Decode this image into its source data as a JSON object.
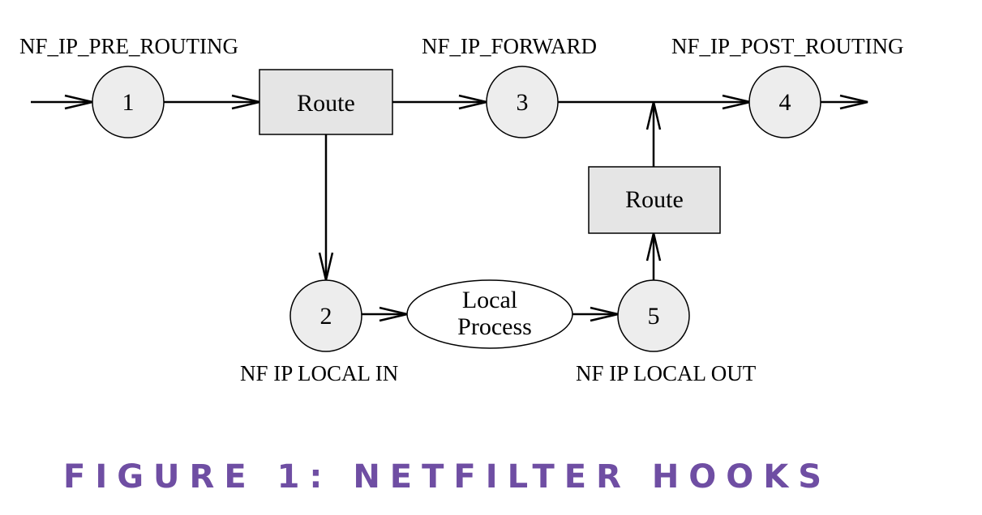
{
  "diagram": {
    "hook_labels": {
      "pre_routing": "NF_IP_PRE_ROUTING",
      "forward": "NF_IP_FORWARD",
      "post_routing": "NF_IP_POST_ROUTING",
      "local_in": "NF IP LOCAL IN",
      "local_out": "NF IP LOCAL OUT"
    },
    "nodes": {
      "hook1": "1",
      "hook2": "2",
      "hook3": "3",
      "hook4": "4",
      "hook5": "5",
      "route_top": "Route",
      "route_right": "Route",
      "local_process_line1": "Local",
      "local_process_line2": "Process"
    },
    "edges": [
      {
        "from": "input",
        "to": "hook1"
      },
      {
        "from": "hook1",
        "to": "route_top"
      },
      {
        "from": "route_top",
        "to": "hook3"
      },
      {
        "from": "route_top",
        "to": "hook2"
      },
      {
        "from": "hook3",
        "to": "hook4"
      },
      {
        "from": "hook2",
        "to": "local_process"
      },
      {
        "from": "local_process",
        "to": "hook5"
      },
      {
        "from": "hook5",
        "to": "route_right"
      },
      {
        "from": "route_right",
        "to": "hook4"
      },
      {
        "from": "hook4",
        "to": "output"
      }
    ],
    "colors": {
      "node_fill": "#ededed",
      "box_fill": "#e5e5e5",
      "caption": "#6f4ea3"
    }
  },
  "caption": "FIGURE 1: NETFILTER HOOKS"
}
